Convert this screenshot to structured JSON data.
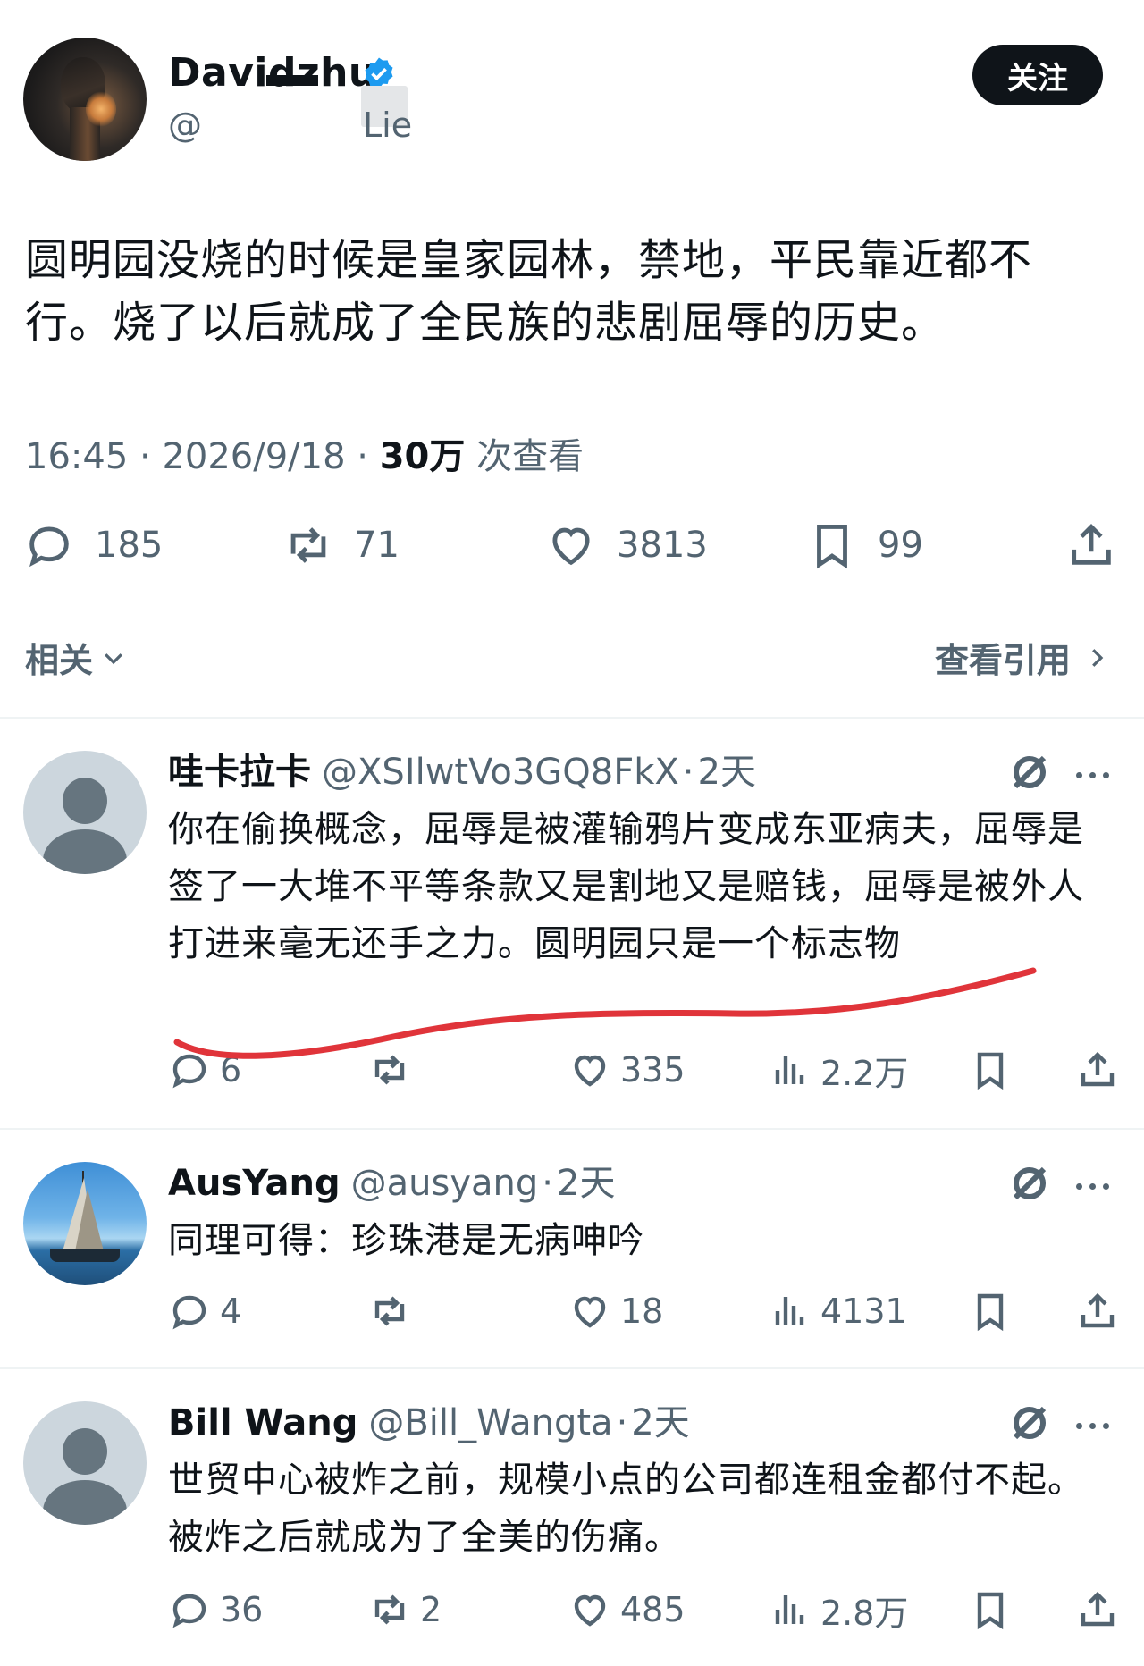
{
  "main_tweet": {
    "display_name": "Davidzhu",
    "handle_visible": "@",
    "handle_tail": "Lie",
    "follow_label": "关注",
    "text": "圆明园没烧的时候是皇家园林，禁地，平民靠近都不行。烧了以后就成了全民族的悲剧屈辱的历史。",
    "time": "16:45",
    "sep": "·",
    "date": "2026/9/18",
    "views_count": "30万",
    "views_label": "次查看",
    "replies": "185",
    "reposts": "71",
    "likes": "3813",
    "bookmarks": "99"
  },
  "related": {
    "left_label": "相关",
    "right_label": "查看引用"
  },
  "replies": [
    {
      "name": "哇卡拉卡",
      "handle": "@XSIlwtVo3GQ8FkX",
      "sep": "·",
      "time": "2天",
      "text": "你在偷换概念，屈辱是被灌输鸦片变成东亚病夫，屈辱是签了一大堆不平等条款又是割地又是赔钱，屈辱是被外人打进来毫无还手之力。圆明园只是一个标志物",
      "replies": "6",
      "reposts": "",
      "likes": "335",
      "views": "2.2万"
    },
    {
      "name": "AusYang",
      "handle": "@ausyang",
      "sep": "·",
      "time": "2天",
      "text": "同理可得：珍珠港是无病呻吟",
      "replies": "4",
      "reposts": "",
      "likes": "18",
      "views": "4131"
    },
    {
      "name": "Bill Wang",
      "handle": "@Bill_Wangta",
      "sep": "·",
      "time": "2天",
      "text": "世贸中心被炸之前，规模小点的公司都连租金都付不起。被炸之后就成为了全美的伤痛。",
      "replies": "36",
      "reposts": "2",
      "likes": "485",
      "views": "2.8万"
    }
  ],
  "icons": {
    "reply": "reply-bubble-icon",
    "repost": "repost-icon",
    "like": "heart-icon",
    "bookmark": "bookmark-icon",
    "share": "share-icon",
    "views": "views-bar-icon",
    "grok": "grok-icon",
    "more": "more-dots-icon",
    "verified": "verified-badge-icon"
  },
  "colors": {
    "text": "#0f1419",
    "secondary": "#536471",
    "verified": "#1d9bf0",
    "underline": "#e0343a"
  }
}
